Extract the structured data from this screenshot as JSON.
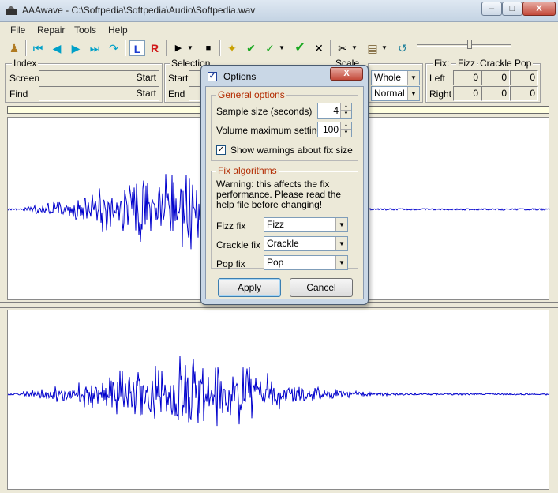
{
  "window": {
    "title": "AAAwave - C:\\Softpedia\\Softpedia\\Audio\\Softpedia.wav",
    "min_label": "–",
    "max_label": "□",
    "close_label": "X"
  },
  "menu": [
    "File",
    "Repair",
    "Tools",
    "Help"
  ],
  "toolbar": {
    "icons": [
      "person-icon",
      "skip-start-icon",
      "rewind-icon",
      "forward-icon",
      "skip-end-icon",
      "loop-icon",
      "left-channel-icon",
      "right-channel-icon",
      "play-icon",
      "play-dropdown-icon",
      "stop-icon",
      "select-fix-icon",
      "fix-all-icon",
      "check-icon",
      "check-dropdown-icon",
      "check-confirm-icon",
      "cancel-icon",
      "cut-icon",
      "cut-dropdown-icon",
      "paste-icon",
      "paste-dropdown-icon",
      "undo-icon"
    ],
    "left_label": "L",
    "right_label": "R"
  },
  "index": {
    "title": "Index",
    "screen_label": "Screen",
    "screen_value": "Start",
    "find_label": "Find",
    "find_value": "Start"
  },
  "selection": {
    "title": "Selection",
    "start_label": "Start",
    "end_label": "End"
  },
  "scale": {
    "title": "Scale",
    "range_value": "Whole",
    "mode_value": "Normal"
  },
  "fix": {
    "title": "Fix:",
    "col_fizz": "Fizz",
    "col_crackle": "Crackle",
    "col_pop": "Pop",
    "left_label": "Left",
    "right_label": "Right",
    "left_values": [
      "0",
      "0",
      "0"
    ],
    "right_values": [
      "0",
      "0",
      "0"
    ]
  },
  "dialog": {
    "title": "Options",
    "close_label": "X",
    "general": {
      "title": "General options",
      "sample_size_label": "Sample size (seconds)",
      "sample_size_value": "4",
      "volume_label": "Volume maximum setting %",
      "volume_value": "100",
      "warnings_label": "Show warnings about fix size",
      "warnings_checked": true
    },
    "fix_algorithms": {
      "title": "Fix algorithms",
      "warning_text": "Warning: this affects the fix performance.  Please read the help file before changing!",
      "fizz_label": "Fizz fix",
      "fizz_value": "Fizz",
      "crackle_label": "Crackle fix",
      "crackle_value": "Crackle",
      "pop_label": "Pop fix",
      "pop_value": "Pop"
    },
    "apply_label": "Apply",
    "cancel_label": "Cancel"
  },
  "colors": {
    "waveform": "#0000cc",
    "fix_group_title": "#b22a00",
    "dialog_frame": "#c9d7e6"
  }
}
